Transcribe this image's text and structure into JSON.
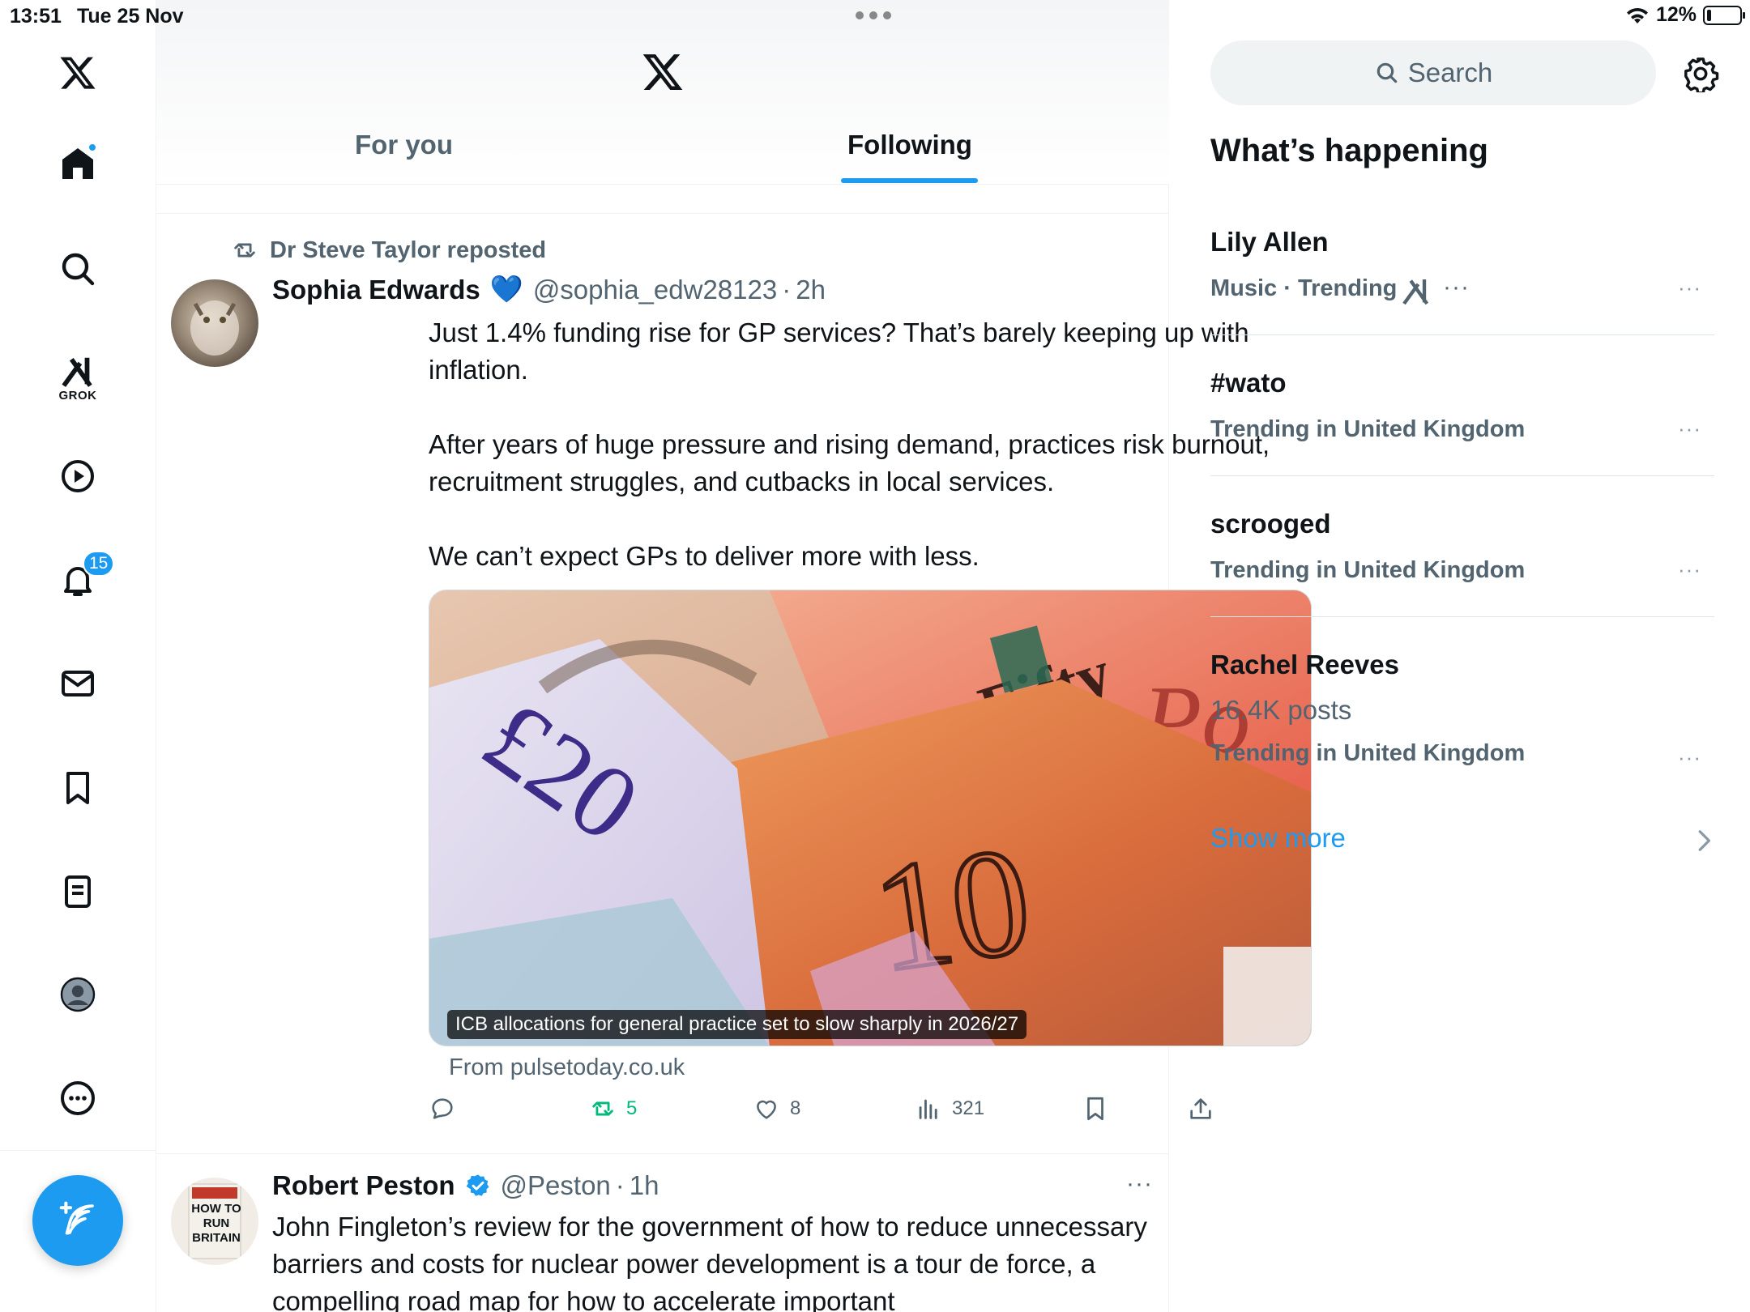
{
  "status_bar": {
    "time": "13:51",
    "date": "Tue 25 Nov",
    "battery": "12%"
  },
  "nav": {
    "grok_label": "GROK",
    "notifications_badge": "15",
    "items": [
      "home-icon",
      "search-icon",
      "grok-icon",
      "video-icon",
      "bell-icon",
      "mail-icon",
      "bookmark-icon",
      "lists-icon",
      "profile-icon",
      "more-icon"
    ]
  },
  "tabs": {
    "for_you": "For you",
    "following": "Following"
  },
  "post1": {
    "repost_by": "Dr Steve Taylor reposted",
    "author": "Sophia Edwards",
    "emoji": "💙",
    "handle": "@sophia_edw28123",
    "sep": "·",
    "time": "2h",
    "text": "Just 1.4% funding rise for GP services? That’s barely keeping up with inflation.\n\nAfter years of huge pressure and rising demand, practices risk burnout, recruitment struggles, and cutbacks in local services.\n\nWe can’t expect GPs to deliver more with less.",
    "card_caption": "ICB allocations for general practice set to slow sharply in 2026/27",
    "card_source": "From pulsetoday.co.uk",
    "retweets": "5",
    "likes": "8",
    "views": "321"
  },
  "post2": {
    "author": "Robert Peston",
    "handle": "@Peston",
    "sep": "·",
    "time": "1h",
    "text": "John Fingleton’s review for the government of how to reduce unnecessary barriers and costs for nuclear power development is a tour de force, a compelling road map for how to accelerate important",
    "avatar_text": "HOW TO RUN BRITAIN"
  },
  "sidebar": {
    "search_placeholder": "Search",
    "title": "What’s happening",
    "trends": [
      {
        "name": "Lily Allen",
        "meta": "Music · Trending"
      },
      {
        "name": "#wato",
        "meta": "Trending in United Kingdom"
      },
      {
        "name": "scrooged",
        "meta": "Trending in United Kingdom"
      },
      {
        "name": "Rachel Reeves",
        "count": "16.4K posts",
        "meta": "Trending in United Kingdom"
      }
    ],
    "show_more": "Show more"
  },
  "colors": {
    "accent": "#1d9bf0",
    "retweet_green": "#00ba7c",
    "secondary_text": "#536471"
  }
}
